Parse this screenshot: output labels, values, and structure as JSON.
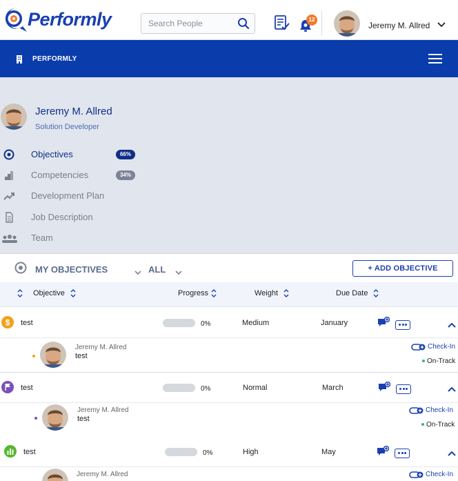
{
  "header": {
    "logo_text": "Performly",
    "search_placeholder": "Search People",
    "notification_count": "12",
    "user_name": "Jeremy M. Allred"
  },
  "bluebar": {
    "brand": "PERFORMLY"
  },
  "profile": {
    "name": "Jeremy M. Allred",
    "role": "Solution Developer",
    "nav": [
      {
        "label": "Objectives",
        "icon": "target-icon",
        "badge": "66%"
      },
      {
        "label": "Competencies",
        "icon": "stairs-icon",
        "badge": "34%"
      },
      {
        "label": "Development Plan",
        "icon": "trend-up-icon"
      },
      {
        "label": "Job Description",
        "icon": "document-icon"
      },
      {
        "label": "Team",
        "icon": "team-icon"
      }
    ]
  },
  "objectives": {
    "title": "MY OBJECTIVES",
    "filter": "ALL",
    "add_button": "+ ADD OBJECTIVE",
    "columns": [
      "Objective",
      "Progress",
      "Weight",
      "Due Date"
    ],
    "rows": [
      {
        "name": "test",
        "progress": 0,
        "progress_text": "0%",
        "weight": "Medium",
        "due": "January",
        "icon": "dollar-icon",
        "icon_color": "#f2a11c",
        "update": {
          "author": "Jeremy M. Allred",
          "text": "test",
          "checkin": "Check-In",
          "status": "On-Track",
          "dot_color": "#f2a11c"
        }
      },
      {
        "name": "test",
        "progress": 0,
        "progress_text": "0%",
        "weight": "Normal",
        "due": "March",
        "icon": "flag-icon",
        "icon_color": "#7b4fb8",
        "update": {
          "author": "Jeremy M. Allred",
          "text": "test",
          "checkin": "Check-In",
          "status": "On-Track",
          "dot_color": "#7b4fb8"
        }
      },
      {
        "name": "test",
        "progress": 0,
        "progress_text": "0%",
        "weight": "High",
        "due": "May",
        "icon": "bar-chart-icon",
        "icon_color": "#56b630",
        "update": {
          "author": "Jeremy M. Allred",
          "text": "",
          "checkin": "Check-In",
          "status": "",
          "dot_color": "#56b630"
        }
      }
    ]
  },
  "colors": {
    "brand_blue": "#0a3dab",
    "panel_bg": "#e1e5ee",
    "badge_orange": "#f07a2a",
    "on_track": "#3cb46e"
  }
}
